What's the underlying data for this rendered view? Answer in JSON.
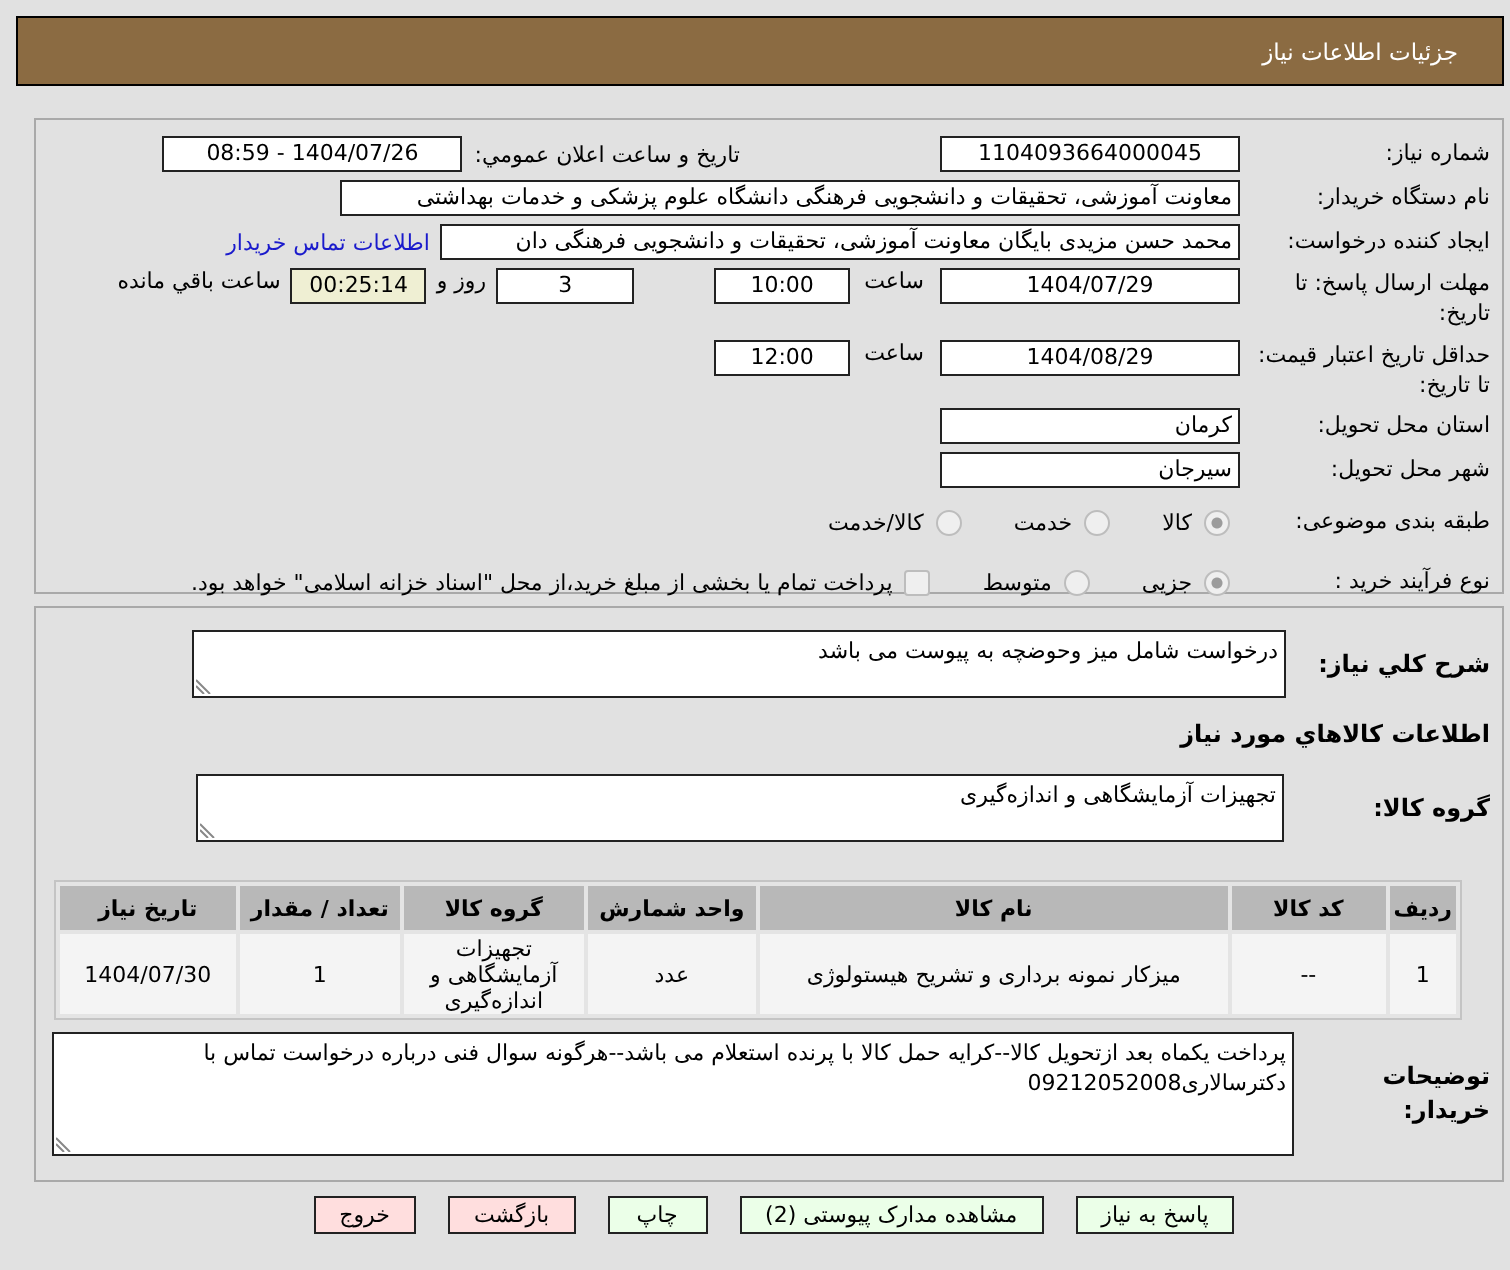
{
  "header": {
    "title": "جزئیات اطلاعات نیاز"
  },
  "details": {
    "need_number": {
      "label": "شماره نیاز:",
      "value": "1104093664000045"
    },
    "announce": {
      "label": "تاریخ و ساعت اعلان عمومي:",
      "value": "1404/07/26 - 08:59"
    },
    "buyer": {
      "label": "نام دستگاه خریدار:",
      "value": "معاونت آموزشی، تحقیقات و دانشجویی فرهنگی دانشگاه علوم پزشکی و خدمات بهداشتی"
    },
    "creator": {
      "label": "ایجاد کننده درخواست:",
      "value": "محمد حسن  مزیدی بایگان معاونت آموزشی، تحقیقات و دانشجویی فرهنگی دان",
      "link": "اطلاعات تماس خریدار"
    },
    "deadline": {
      "label": "مهلت ارسال پاسخ: تا تاریخ:",
      "date": "1404/07/29",
      "time_label": "ساعت",
      "time": "10:00",
      "days": "3",
      "days_label": "روز و",
      "remaining": "00:25:14",
      "remaining_label": "ساعت باقي مانده"
    },
    "validity": {
      "label": "حداقل تاریخ اعتبار قیمت: تا تاریخ:",
      "date": "1404/08/29",
      "time_label": "ساعت",
      "time": "12:00"
    },
    "province": {
      "label": "استان محل تحویل:",
      "value": "کرمان"
    },
    "city": {
      "label": "شهر محل تحویل:",
      "value": "سیرجان"
    },
    "category": {
      "label": "طبقه بندی موضوعی:",
      "options": [
        {
          "label": "کالا",
          "selected": true
        },
        {
          "label": "خدمت",
          "selected": false
        },
        {
          "label": "کالا/خدمت",
          "selected": false
        }
      ]
    },
    "process": {
      "label": "نوع فرآیند خرید :",
      "options": [
        {
          "label": "جزیی",
          "selected": true
        },
        {
          "label": "متوسط",
          "selected": false
        }
      ],
      "checkbox": {
        "label": "پرداخت تمام یا بخشی از مبلغ خرید،از محل \"اسناد خزانه اسلامی\" خواهد بود.",
        "checked": false
      }
    }
  },
  "description": {
    "label": "شرح کلي نیاز:",
    "value": "درخواست شامل میز وحوضچه به پیوست می باشد"
  },
  "goods": {
    "title": "اطلاعات کالاهاي مورد نیاز",
    "group_label": "گروه کالا:",
    "group_value": "تجهیزات آزمایشگاهی و اندازه‌گیری",
    "table": {
      "columns": [
        "ردیف",
        "کد کالا",
        "نام کالا",
        "واحد شمارش",
        "گروه کالا",
        "تعداد / مقدار",
        "تاریخ نیاز"
      ],
      "rows": [
        [
          "1",
          "--",
          "میزکار نمونه برداری و تشریح هیستولوژی",
          "عدد",
          "تجهیزات آزمایشگاهی و اندازه‌گیری",
          "1",
          "1404/07/30"
        ]
      ]
    }
  },
  "buyer_notes": {
    "label": "توضیحات خریدار:",
    "value": "پرداخت یکماه بعد ازتحویل کالا--کرایه حمل کالا با پرنده استعلام می باشد--هرگونه سوال فنی درباره درخواست تماس با دکترسالاری09212052008"
  },
  "buttons": [
    {
      "label": "پاسخ به نیاز",
      "kind": "primary"
    },
    {
      "label": "مشاهده مدارک پیوستی (2)",
      "kind": "primary"
    },
    {
      "label": "چاپ",
      "kind": "primary"
    },
    {
      "label": "بازگشت",
      "kind": "danger"
    },
    {
      "label": "خروج",
      "kind": "danger"
    }
  ]
}
